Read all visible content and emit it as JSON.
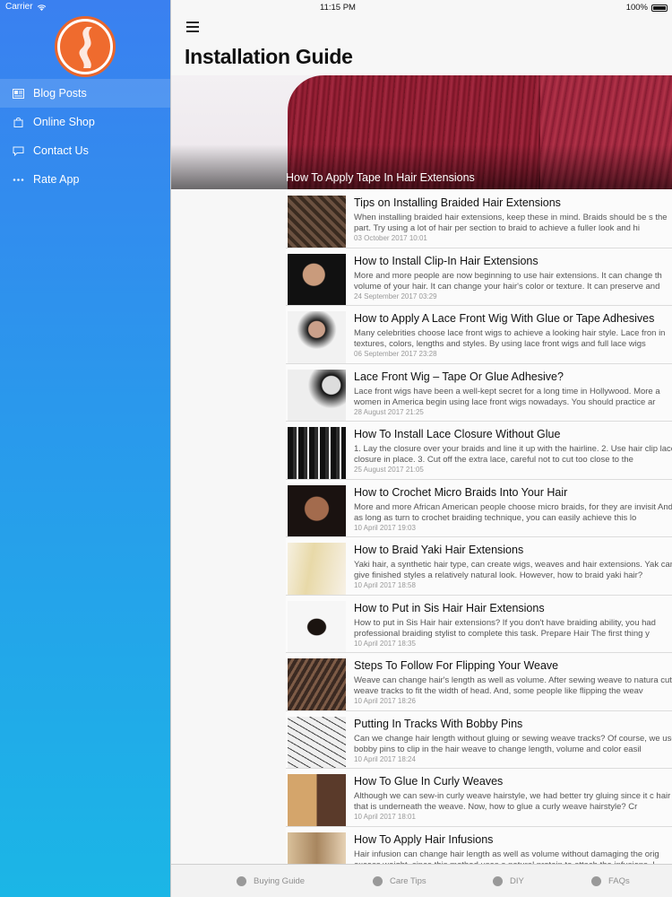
{
  "status": {
    "carrier": "Carrier",
    "time": "11:15 PM",
    "battery": "100%"
  },
  "sidebar": {
    "items": [
      {
        "label": "Blog Posts",
        "icon": "news-icon",
        "active": true
      },
      {
        "label": "Online Shop",
        "icon": "bag-icon",
        "active": false
      },
      {
        "label": "Contact Us",
        "icon": "chat-icon",
        "active": false
      },
      {
        "label": "Rate App",
        "icon": "dots-icon",
        "active": false
      }
    ]
  },
  "header": {
    "title": "Installation Guide"
  },
  "hero": {
    "caption": "How To Apply Tape In Hair Extensions"
  },
  "posts": [
    {
      "title": "Tips on Installing Braided Hair Extensions",
      "excerpt": "When installing braided hair extensions, keep these in mind.   Braids should be s the part. Try using a lot of hair per section to braid to achieve a fuller look and hi",
      "date": "03 October 2017 10:01"
    },
    {
      "title": "How to Install Clip-In Hair Extensions",
      "excerpt": "More and more people are now beginning to use hair extensions. It can change th volume of your hair. It can change your hair's color or texture. It can preserve and",
      "date": "24 September 2017 03:29"
    },
    {
      "title": "How to Apply A Lace Front Wig With Glue or Tape Adhesives",
      "excerpt": "Many celebrities choose lace front wigs to achieve a looking hair style. Lace fron in textures, colors, lengths and styles. By using lace front wigs and full lace wigs",
      "date": "06 September 2017 23:28"
    },
    {
      "title": "Lace Front Wig – Tape Or Glue Adhesive?",
      "excerpt": "Lace front wigs have been a well-kept secret for a long time in Hollywood. More a women in America begin using lace front wigs nowadays. You should practice ar",
      "date": "28 August 2017 21:25"
    },
    {
      "title": "How To Install Lace Closure Without Glue",
      "excerpt": "1. Lay the closure over your braids and line it up with the hairline.  2. Use hair clip lace closure in place.  3. Cut off the extra lace, careful not to cut too close to the",
      "date": "25 August 2017 21:05"
    },
    {
      "title": "How to Crochet Micro Braids Into Your Hair",
      "excerpt": "More and more African American people choose micro braids, for they are invisit And, as long as turn to crochet braiding technique, you can easily achieve this lo",
      "date": "10 April 2017 19:03"
    },
    {
      "title": "How to Braid Yaki Hair Extensions",
      "excerpt": "Yaki hair, a synthetic hair type, can create wigs, weaves and hair extensions.  Yak can give finished styles a relatively natural look. However, how to braid yaki hair?",
      "date": "10 April 2017 18:58"
    },
    {
      "title": "How to Put in Sis Hair Hair Extensions",
      "excerpt": "How to put in Sis Hair hair extensions? If you don't have braiding ability, you had professional braiding stylist to complete this task.  Prepare Hair   The first thing y",
      "date": "10 April 2017 18:35"
    },
    {
      "title": "Steps To Follow For Flipping Your Weave",
      "excerpt": "Weave can change hair's length as well as volume. After sewing weave to natura cut weave tracks to fit the width of head. And, some people like flipping the weav",
      "date": "10 April 2017 18:26"
    },
    {
      "title": "Putting In Tracks With Bobby Pins",
      "excerpt": "Can we change hair length without gluing or sewing weave tracks? Of course, we use bobby pins to clip in the hair weave to change length, volume and color easil",
      "date": "10 April 2017 18:24"
    },
    {
      "title": "How To Glue In Curly Weaves",
      "excerpt": "Although we can sew-in curly weave hairstyle, we had better try gluing since it c hair that is underneath the weave. Now, how to glue a curly weave hairstyle?   Cr",
      "date": "10 April 2017 18:01"
    },
    {
      "title": "How To Apply Hair Infusions",
      "excerpt": "Hair infusion can change hair length as well as volume without damaging the orig excess weight, since this method uses a natural protein to attach the infusions. I",
      "date": ""
    }
  ],
  "tabs": [
    {
      "label": "Buying Guide"
    },
    {
      "label": "Care Tips"
    },
    {
      "label": "DIY"
    },
    {
      "label": "FAQs"
    }
  ]
}
